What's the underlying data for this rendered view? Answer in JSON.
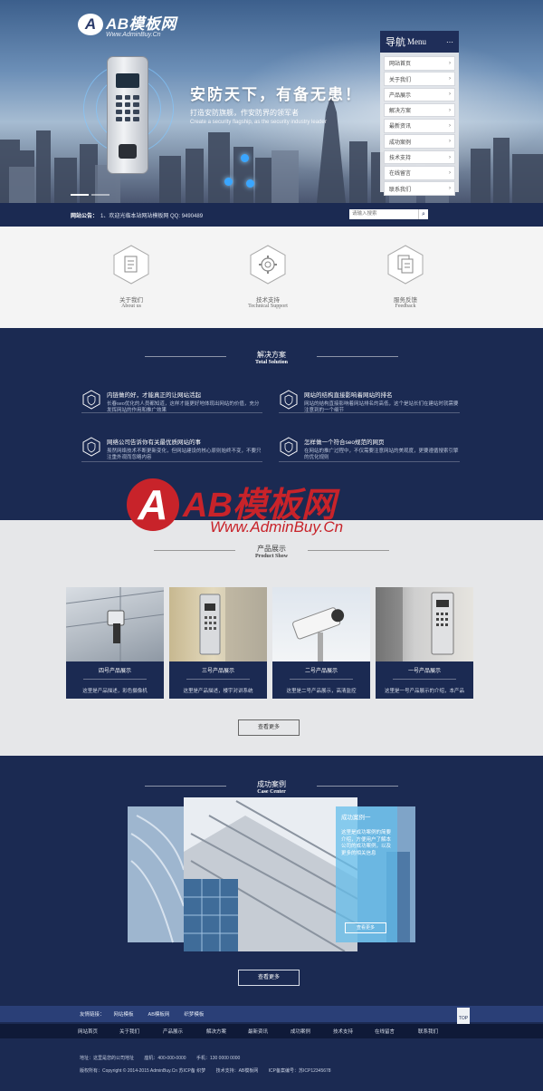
{
  "logo": {
    "mark": "A",
    "brand": "AB模板网",
    "url": "Www.AdminBuy.Cn"
  },
  "hero": {
    "slogan": "安防天下，有备无患！",
    "sub": "打造安防旗舰，作安防界的领军者",
    "en": "Create a security flagship, as the security industry leader"
  },
  "menu": {
    "title_cn": "导航",
    "title_en": "Menu",
    "items": [
      {
        "label": "网站首页"
      },
      {
        "label": "关于我们"
      },
      {
        "label": "产品展示"
      },
      {
        "label": "解决方案"
      },
      {
        "label": "最新资讯"
      },
      {
        "label": "成功案例"
      },
      {
        "label": "技术支持"
      },
      {
        "label": "在线留言"
      },
      {
        "label": "联系我们"
      }
    ],
    "arrow": "›"
  },
  "notice": {
    "label": "网站公告：",
    "text": "1、欢迎光临本站网站模板网   QQ: 9490489",
    "search_placeholder": "请输入搜索",
    "search_icon": "search-icon"
  },
  "services": [
    {
      "cn": "关于我们",
      "en": "About us",
      "icon": "document-icon"
    },
    {
      "cn": "技术支持",
      "en": "Technical Support",
      "icon": "gear-icon"
    },
    {
      "cn": "服务反馈",
      "en": "Feedback",
      "icon": "copy-icon"
    }
  ],
  "solutions": {
    "title_cn": "解决方案",
    "title_en": "Total Solution",
    "items": [
      {
        "t": "内链做的好，才能真正的让网站活起",
        "d": "长春seo优化的人员都知道，这样才能更好地体现出网站的价值，充分发挥网站的作用和推广效果"
      },
      {
        "t": "网站的结构直接影响着网站的排名",
        "d": "网站的结构直接影响着网站排名的高低，这个是站长们在建站时就需要注意到的一个细节"
      },
      {
        "t": "网络公司告诉你有关最优质网站的事",
        "d": "虽然网络技术不断更新变化，但网站建设的核心原则始终不变，不要只注重外观而忽略内容"
      },
      {
        "t": "怎样做一个符合seo规范的网页",
        "d": "在网站的推广过程中，不仅需要注意网站的美观度，更要遵循搜索引擎的优化规则"
      }
    ]
  },
  "watermark": {
    "mark": "A",
    "brand": "AB模板网",
    "url": "Www.AdminBuy.Cn"
  },
  "products": {
    "title_cn": "产品展示",
    "title_en": "Product Show",
    "items": [
      {
        "name": "四号产品展示",
        "desc": "这里是产品描述，彩色摄像机"
      },
      {
        "name": "三号产品展示",
        "desc": "这里是产品描述，楼宇对讲系统"
      },
      {
        "name": "二号产品展示",
        "desc": "这里是二号产品展示，高清监控"
      },
      {
        "name": "一号产品展示",
        "desc": "这里是一号产品展示的介绍，本产品"
      }
    ],
    "more": "查看更多"
  },
  "cases": {
    "title_cn": "成功案例",
    "title_en": "Case Center",
    "info_title": "成功案例一",
    "info_desc": "这里是成功案例的简要介绍，方便用户了解本公司的成功案例，以及更多的相关信息",
    "info_btn": "查看更多",
    "more": "查看更多"
  },
  "links": {
    "label": "友情链接：",
    "items": [
      "网站模板",
      "AB模板网",
      "织梦模板"
    ],
    "top": "TOP"
  },
  "foot_nav": [
    "网站首页",
    "关于我们",
    "产品展示",
    "解决方案",
    "最新资讯",
    "成功案例",
    "技术支持",
    "在线留言",
    "联系我们"
  ],
  "foot_info": {
    "address": "地址：这里是您的公司地址",
    "tel": "座机：400-000-0000",
    "phone": "手机：130 0000 0000",
    "copyright": "版权所有：Copyright © 2014-2015 AdminBuy.Cn  苏ICP备 织梦",
    "support": "技术支持：AB模板网",
    "icp": "ICP备案编号：苏ICP12345678"
  },
  "colors": {
    "navy": "#1b2a52",
    "watermark_red": "#c8232a",
    "case_info": "#64bee8"
  }
}
